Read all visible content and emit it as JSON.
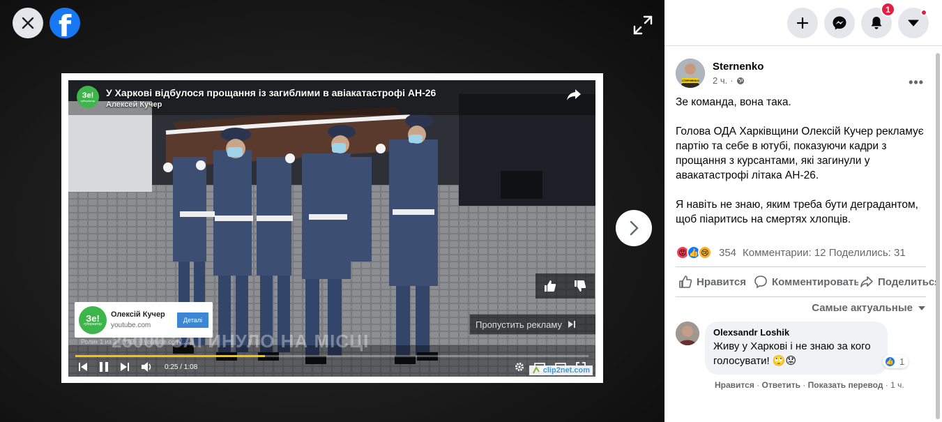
{
  "viewer": {
    "video": {
      "title": "У Харкові відбулося прощання із загиблими в авіакатастрофі АН-26",
      "channel": "Алексей Кучер",
      "channel_logo_text": "Зе!",
      "channel_logo_sub": "губернатор",
      "ad": {
        "name": "Олексій Кучер",
        "url": "youtube.com",
        "button": "Деталі"
      },
      "skip_ad": "Пропустить рекламу",
      "ad_info": "Ролик 1 из 2 · 0:43  ⓘ   youtube.com/...",
      "caption_overlay": "25000 ЗАГИНУЛО НА МІСЦІ",
      "time": "0:25 / 1:08",
      "progress": 0.37,
      "watermark": "clip2net.com"
    }
  },
  "topbar": {
    "notification_count": "1"
  },
  "post": {
    "author": "Sternenko",
    "time": "2 ч.",
    "avatar_text": "СТЕРНЕНКО",
    "paragraphs": [
      "Зе команда, вона така.",
      "Голова ОДА Харківщини Олексій Кучер рекламує партію та себе в ютубі, показуючи кадри з прощання з курсантами, які загинули у авакатастрофі літака АН-26.",
      "Я навіть не знаю, яким треба бути деградантом, щоб піаритись на смертях хлопців."
    ],
    "reaction_count": "354",
    "stats": "Комментарии: 12  Поделились: 31",
    "actions": {
      "like": "Нравится",
      "comment": "Комментировать",
      "share": "Поделиться"
    },
    "sort_label": "Самые актуальные"
  },
  "comment": {
    "author": "Olexsandr Loshik",
    "text": "Живу у Харкові і не знаю за кого голосувати! 🙄😟",
    "reaction_count": "1",
    "like": "Нравится",
    "reply": "Ответить",
    "translate": "Показать перевод",
    "time": "1 ч."
  },
  "colors": {
    "facebook_blue": "#1877f2",
    "badge_red": "#e41e3f",
    "progress_yellow": "#f9c500"
  }
}
